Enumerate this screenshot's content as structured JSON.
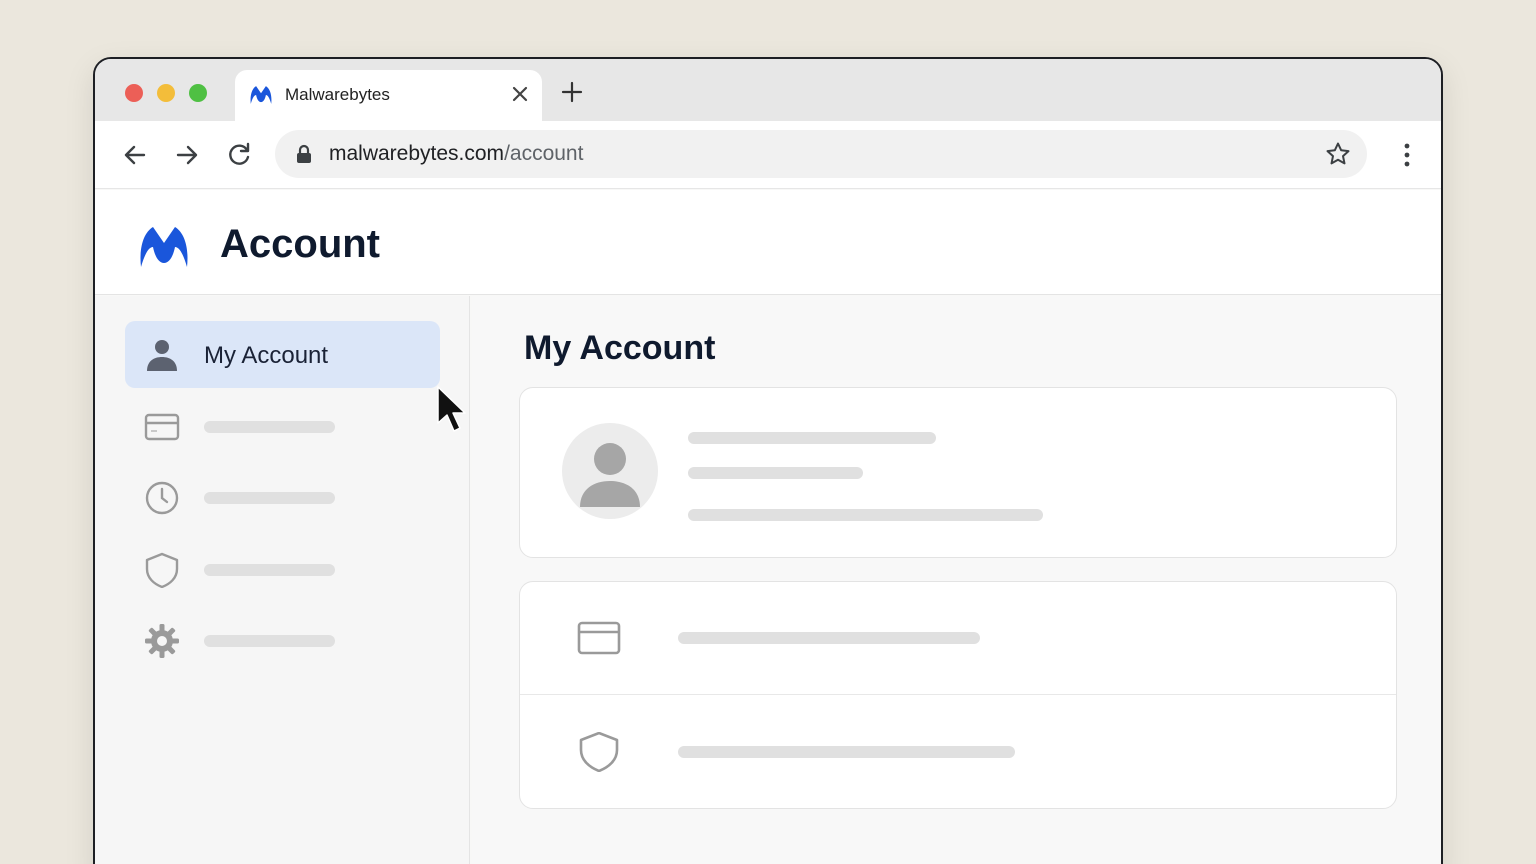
{
  "browser": {
    "tab": {
      "title": "Malwarebytes",
      "favicon": "malwarebytes-logo-icon"
    },
    "address_bar": {
      "host": "malwarebytes.com",
      "path": "/account"
    }
  },
  "page": {
    "header_title": "Account",
    "main_title": "My Account"
  },
  "sidebar": {
    "items": [
      {
        "label": "My Account",
        "icon": "person-icon",
        "active": true
      },
      {
        "label": "",
        "icon": "credit-card-icon"
      },
      {
        "label": "",
        "icon": "clock-icon"
      },
      {
        "label": "",
        "icon": "shield-icon"
      },
      {
        "label": "",
        "icon": "gear-icon"
      }
    ]
  },
  "colors": {
    "brand_blue": "#1a56db",
    "active_item_bg": "#dbe6f8",
    "skeleton": "#e0e0e0"
  }
}
